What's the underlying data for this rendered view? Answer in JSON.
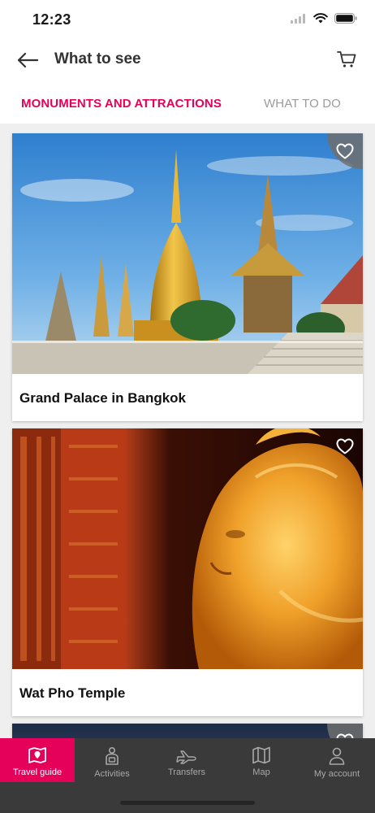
{
  "status": {
    "time": "12:23"
  },
  "header": {
    "title": "What to see"
  },
  "tabs": [
    {
      "label": "MONUMENTS AND ATTRACTIONS",
      "active": true
    },
    {
      "label": "WHAT TO DO",
      "active": false
    }
  ],
  "cards": [
    {
      "title": "Grand Palace in Bangkok",
      "icon": "heart-icon"
    },
    {
      "title": "Wat Pho Temple",
      "icon": "heart-icon"
    }
  ],
  "tabbar": [
    {
      "label": "Travel guide",
      "icon": "map-book-icon",
      "active": true
    },
    {
      "label": "Activities",
      "icon": "activities-icon",
      "active": false
    },
    {
      "label": "Transfers",
      "icon": "plane-icon",
      "active": false
    },
    {
      "label": "Map",
      "icon": "map-icon",
      "active": false
    },
    {
      "label": "My account",
      "icon": "person-icon",
      "active": false
    }
  ],
  "colors": {
    "accent": "#e5005a",
    "tabbar_bg": "#3a3a3a",
    "inactive_tab": "#9b9b9b"
  }
}
